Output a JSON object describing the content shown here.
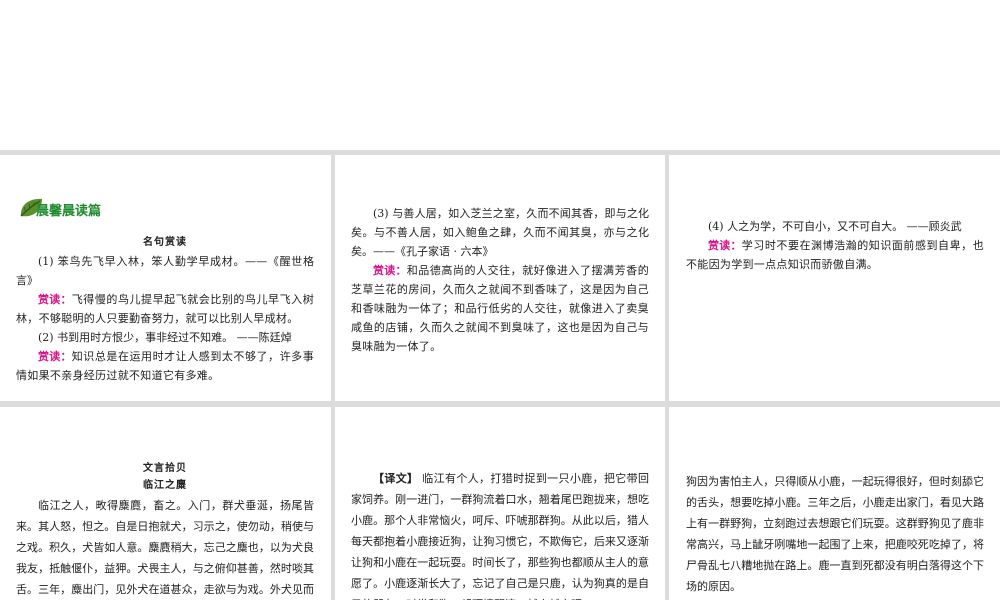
{
  "panels": {
    "p1": {
      "header": "晨馨晨读篇",
      "subtitle": "名句赏读",
      "q1": "(1) 笨鸟先飞早入林，笨人勤学早成材。——《醒世格言》",
      "q1_label": "赏读：",
      "q1_text": "飞得慢的鸟儿提早起飞就会比别的鸟儿早飞入树林，不够聪明的人只要勤奋努力，就可以比别人早成材。",
      "q2": "(2) 书到用时方恨少，事非经过不知难。 ——陈廷焯",
      "q2_label": "赏读：",
      "q2_text": "知识总是在运用时才让人感到太不够了，许多事情如果不亲身经历过就不知道它有多难。"
    },
    "p2": {
      "q3": "(3) 与善人居，如入芝兰之室，久而不闻其香，即与之化矣。与不善人居，如入鲍鱼之肆，久而不闻其臭，亦与之化矣。——《孔子家语 · 六本》",
      "q3_label": "赏读：",
      "q3_text": "和品德高尚的人交往，就好像进入了摆满芳香的芝草兰花的房间，久而久之就闻不到香味了，这是因为自己和香味融为一体了；和品行低劣的人交往，就像进入了卖臭咸鱼的店铺，久而久之就闻不到臭味了，这也是因为自己与臭味融为一体了。"
    },
    "p3": {
      "q4": "(4) 人之为学，不可自小，又不可自大。 ——顾炎武",
      "q4_label": "赏读：",
      "q4_text": "学习时不要在渊博浩瀚的知识面前感到自卑，也不能因为学到一点点知识而骄傲自满。"
    },
    "p4": {
      "title": "文言拾贝",
      "subtitle": "临江之麋",
      "text": "临江之人，畋得麋麑，畜之。入门，群犬垂涎，扬尾皆来。其人怒，怛之。自是日抱就犬，习示之，使勿动，稍使与之戏。积久，犬皆如人意。麋麑稍大，忘己之麋也，以为犬良我友，抵触偃仆，益狎。犬畏主人，与之俯仰甚善，然时啖其舌。三年，麋出门，见外犬在道甚众，走欲与为戏。外犬见而喜且怒，共杀食之，狼藉道上。麋至死不悟。"
    },
    "p5": {
      "label": "【译文】",
      "text": "临江有个人，打猎时捉到一只小鹿，把它带回家饲养。刚一进门，一群狗流着口水，翘着尾巴跑拢来，想吃小鹿。那个人非常恼火，呵斥、吓唬那群狗。从此以后，猎人每天都抱着小鹿接近狗，让狗习惯它，不欺侮它，后来又逐渐让狗和小鹿在一起玩耍。时间长了，那些狗也都顺从主人的意愿了。小鹿逐渐长大了，忘记了自己是只鹿，认为狗真的是自己的朋友，时常和狗一起顶撞翻滚，越来越亲昵。"
    },
    "p6": {
      "text": "狗因为害怕主人，只得顺从小鹿，一起玩得很好，但时刻舔它的舌头，想要吃掉小鹿。三年之后，小鹿走出家门，看见大路上有一群野狗，立刻跑过去想跟它们玩耍。这群野狗见了鹿非常高兴，马上龇牙咧嘴地一起围了上来，把鹿咬死吃掉了，将尸骨乱七八糟地抛在路上。鹿一直到死都没有明白落得这个下场的原因。"
    }
  }
}
